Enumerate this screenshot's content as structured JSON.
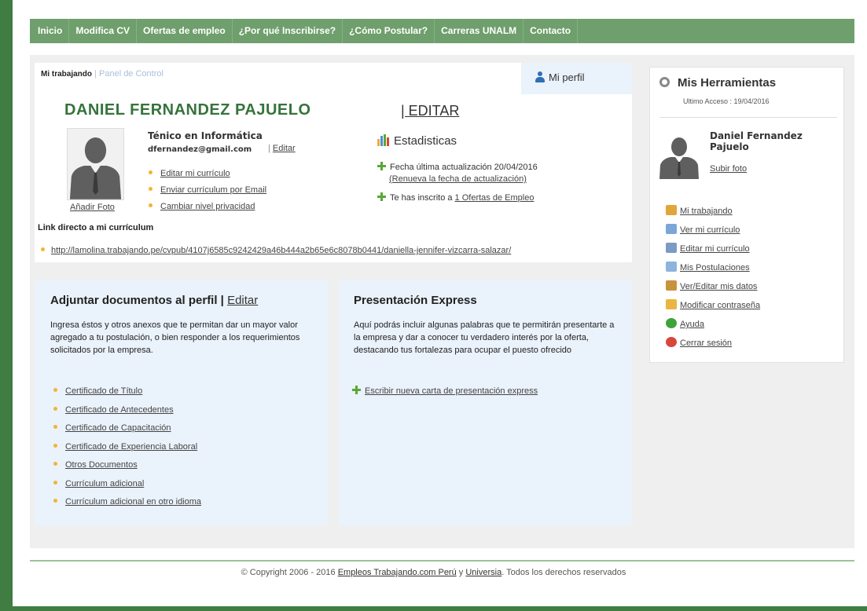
{
  "nav": [
    "Inicio",
    "Modifica CV",
    "Ofertas de empleo",
    "¿Por qué Inscribirse?",
    "¿Cómo Postular?",
    "Carreras UNALM",
    "Contacto"
  ],
  "breadcrumb": {
    "current": "Mi trabajando",
    "sep": " | ",
    "link": "Panel de Control"
  },
  "miperfil": "Mi perfil",
  "profile": {
    "name": "DANIEL FERNANDEZ PAJUELO",
    "editar": "| EDITAR",
    "title": "Ténico en Informática",
    "email": "dfernandez@gmail.com",
    "email_edit_sep": " | ",
    "email_edit": "Editar",
    "add_photo": "Añadir Foto",
    "links": [
      "Editar mi currículo",
      "Enviar currículum por Email",
      "Cambiar nivel privacidad"
    ]
  },
  "stats": {
    "title": "Estadisticas",
    "line1": "Fecha última actualización 20/04/2016",
    "line1_link": "(Renueva la fecha de actualización)",
    "line2_prefix": "Te has inscrito a ",
    "line2_link": "1 Ofertas de Empleo"
  },
  "direct_link": {
    "label": "Link directo a mi currículum",
    "url": "http://lamolina.trabajando.pe/cvpub/4107j6585c9242429a46b444a2b65e6c8078b0441/daniella-jennifer-vizcarra-salazar/"
  },
  "docs": {
    "title": "Adjuntar documentos al perfil | ",
    "edit": "Editar",
    "desc": "Ingresa éstos y otros anexos que te permitan dar un mayor valor agregado a tu postulación, o bien responder a los requerimientos solicitados por la empresa.",
    "items": [
      "Certificado de Título",
      "Certificado de Antecedentes",
      "Certificado de Capacitación",
      "Certificado de Experiencia Laboral",
      "Otros Documentos",
      "Currículum adicional",
      "Currículum adicional en otro idioma"
    ]
  },
  "express": {
    "title": "Presentación Express",
    "desc": "Aquí podrás incluir algunas palabras que te permitirán presentarte a la empresa y dar a conocer tu verdadero interés por la oferta, destacando tus fortalezas para ocupar el puesto ofrecido",
    "link": "Escribir nueva carta de presentación express"
  },
  "tools": {
    "title": "Mis Herramientas",
    "last_access": "Ultimo Acceso : 19/04/2016",
    "name": "Daniel Fernandez Pajuelo",
    "upload": "Subir foto",
    "items": [
      {
        "label": "Mi trabajando",
        "icon": "home-icon",
        "color": "#e0a63a"
      },
      {
        "label": "Ver mi currículo",
        "icon": "document-icon",
        "color": "#7aa7d8"
      },
      {
        "label": "Editar mi currículo",
        "icon": "edit-document-icon",
        "color": "#7b9bc4"
      },
      {
        "label": "Mis Postulaciones",
        "icon": "postulations-icon",
        "color": "#8db4dd"
      },
      {
        "label": "Ver/Editar mis datos",
        "icon": "user-data-icon",
        "color": "#c9923d"
      },
      {
        "label": "Modificar contraseña",
        "icon": "key-icon",
        "color": "#e9b642"
      },
      {
        "label": "Ayuda",
        "icon": "help-icon",
        "color": "#3fa33a"
      },
      {
        "label": "Cerrar sesión",
        "icon": "logout-icon",
        "color": "#d9473c"
      }
    ]
  },
  "footer": {
    "pre": "© Copyright 2006 - 2016 ",
    "link1": "Empleos Trabajando.com Perú",
    "mid": " y ",
    "link2": "Universia",
    "post": ". Todos los derechos reservados"
  }
}
